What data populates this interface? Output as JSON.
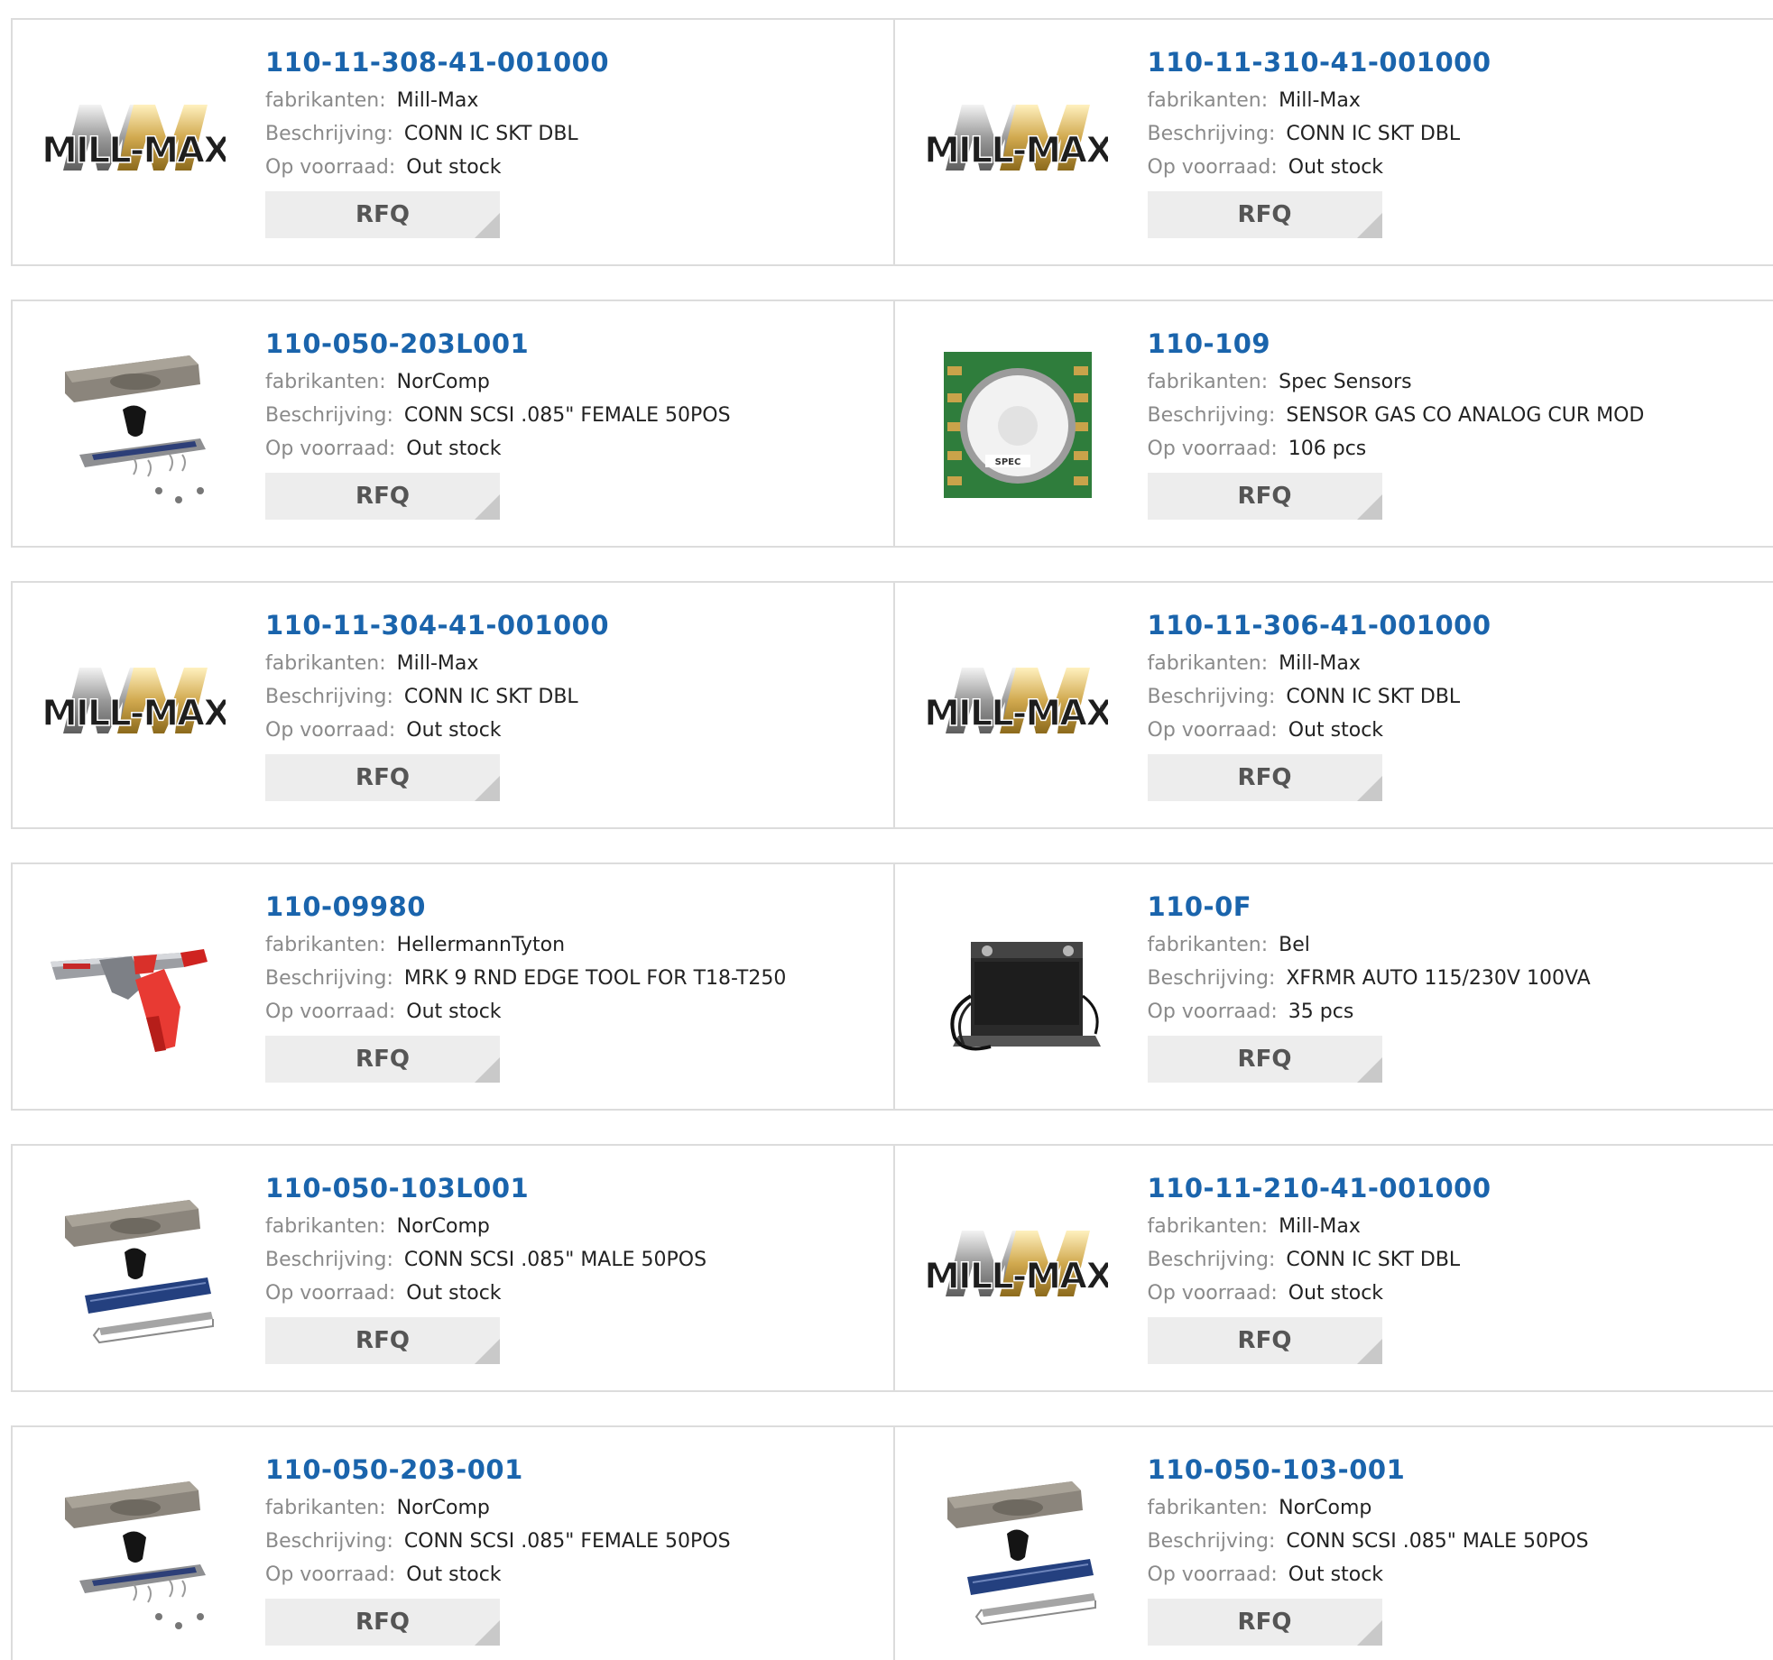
{
  "labels": {
    "manufacturer": "fabrikanten:",
    "description": "Beschrijving:",
    "stock": "Op voorraad:",
    "rfq": "RFQ"
  },
  "products": [
    {
      "part": "110-11-308-41-001000",
      "manufacturer": "Mill-Max",
      "description": "CONN IC SKT DBL",
      "stock": "Out stock",
      "image": "millmax-logo"
    },
    {
      "part": "110-11-310-41-001000",
      "manufacturer": "Mill-Max",
      "description": "CONN IC SKT DBL",
      "stock": "Out stock",
      "image": "millmax-logo"
    },
    {
      "part": "110-050-203L001",
      "manufacturer": "NorComp",
      "description": "CONN SCSI .085\" FEMALE 50POS",
      "stock": "Out stock",
      "image": "scsi-female-kit"
    },
    {
      "part": "110-109",
      "manufacturer": "Spec Sensors",
      "description": "SENSOR GAS CO ANALOG CUR MOD",
      "stock": "106 pcs",
      "image": "gas-sensor-module"
    },
    {
      "part": "110-11-304-41-001000",
      "manufacturer": "Mill-Max",
      "description": "CONN IC SKT DBL",
      "stock": "Out stock",
      "image": "millmax-logo"
    },
    {
      "part": "110-11-306-41-001000",
      "manufacturer": "Mill-Max",
      "description": "CONN IC SKT DBL",
      "stock": "Out stock",
      "image": "millmax-logo"
    },
    {
      "part": "110-09980",
      "manufacturer": "HellermannTyton",
      "description": "MRK 9 RND EDGE TOOL FOR T18-T250",
      "stock": "Out stock",
      "image": "tie-gun-tool"
    },
    {
      "part": "110-0F",
      "manufacturer": "Bel",
      "description": "XFRMR AUTO 115/230V 100VA",
      "stock": "35 pcs",
      "image": "transformer"
    },
    {
      "part": "110-050-103L001",
      "manufacturer": "NorComp",
      "description": "CONN SCSI .085\" MALE 50POS",
      "stock": "Out stock",
      "image": "scsi-male-kit"
    },
    {
      "part": "110-11-210-41-001000",
      "manufacturer": "Mill-Max",
      "description": "CONN IC SKT DBL",
      "stock": "Out stock",
      "image": "millmax-logo"
    },
    {
      "part": "110-050-203-001",
      "manufacturer": "NorComp",
      "description": "CONN SCSI .085\" FEMALE 50POS",
      "stock": "Out stock",
      "image": "scsi-female-kit"
    },
    {
      "part": "110-050-103-001",
      "manufacturer": "NorComp",
      "description": "CONN SCSI .085\" MALE 50POS",
      "stock": "Out stock",
      "image": "scsi-male-kit"
    }
  ],
  "colors": {
    "link": "#1a64ac",
    "label": "#8a8a8a",
    "value": "#222222",
    "button_bg": "#ededed",
    "border": "#dcdcdc"
  }
}
